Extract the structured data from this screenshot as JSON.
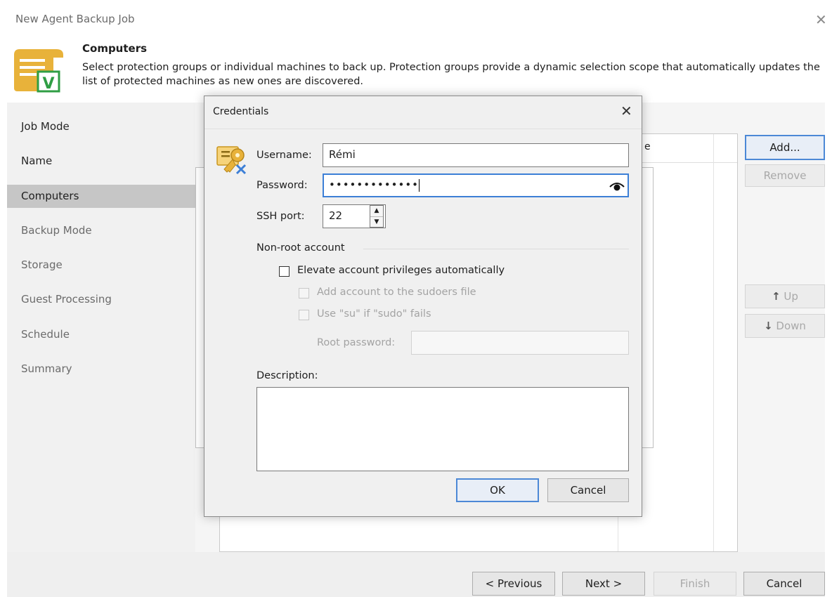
{
  "window": {
    "title": "New Agent Backup Job",
    "close_glyph": "✕"
  },
  "header": {
    "title": "Computers",
    "description": "Select protection groups or individual machines to back up. Protection groups provide a dynamic selection scope that automatically updates the list of protected machines as new ones are discovered.",
    "icon": "computers-job-icon"
  },
  "sidebar": {
    "items": [
      {
        "label": "Job Mode",
        "state": "done"
      },
      {
        "label": "Name",
        "state": "done"
      },
      {
        "label": "Computers",
        "state": "active"
      },
      {
        "label": "Backup Mode",
        "state": "pending"
      },
      {
        "label": "Storage",
        "state": "pending"
      },
      {
        "label": "Guest Processing",
        "state": "pending"
      },
      {
        "label": "Schedule",
        "state": "pending"
      },
      {
        "label": "Summary",
        "state": "pending"
      }
    ]
  },
  "table": {
    "partial_header": "e"
  },
  "side_buttons": {
    "add": "Add...",
    "remove": "Remove",
    "up": "Up",
    "down": "Down",
    "up_icon": "↑",
    "down_icon": "↓"
  },
  "footer": {
    "previous": "< Previous",
    "next": "Next >",
    "finish": "Finish",
    "cancel": "Cancel"
  },
  "dialog": {
    "title": "Credentials",
    "close_glyph": "✕",
    "icon": "credentials-key-icon",
    "username_label": "Username:",
    "username_value": "Rémi",
    "password_label": "Password:",
    "password_value": "•••••••••••••",
    "show_password_icon": "eye-icon",
    "ssh_port_label": "SSH port:",
    "ssh_port_value": "22",
    "nonroot_group": "Non-root account",
    "elevate_label": "Elevate account privileges automatically",
    "sudoers_label": "Add account to the sudoers file",
    "su_label": "Use \"su\" if \"sudo\" fails",
    "root_password_label": "Root password:",
    "root_password_value": "",
    "description_label": "Description:",
    "description_value": "",
    "ok": "OK",
    "cancel": "Cancel"
  },
  "colors": {
    "accent_focus": "#3c7fd6",
    "sidebar_active": "#c6c6c6",
    "icon_gold": "#e8b23a",
    "icon_green": "#2f9e44"
  }
}
